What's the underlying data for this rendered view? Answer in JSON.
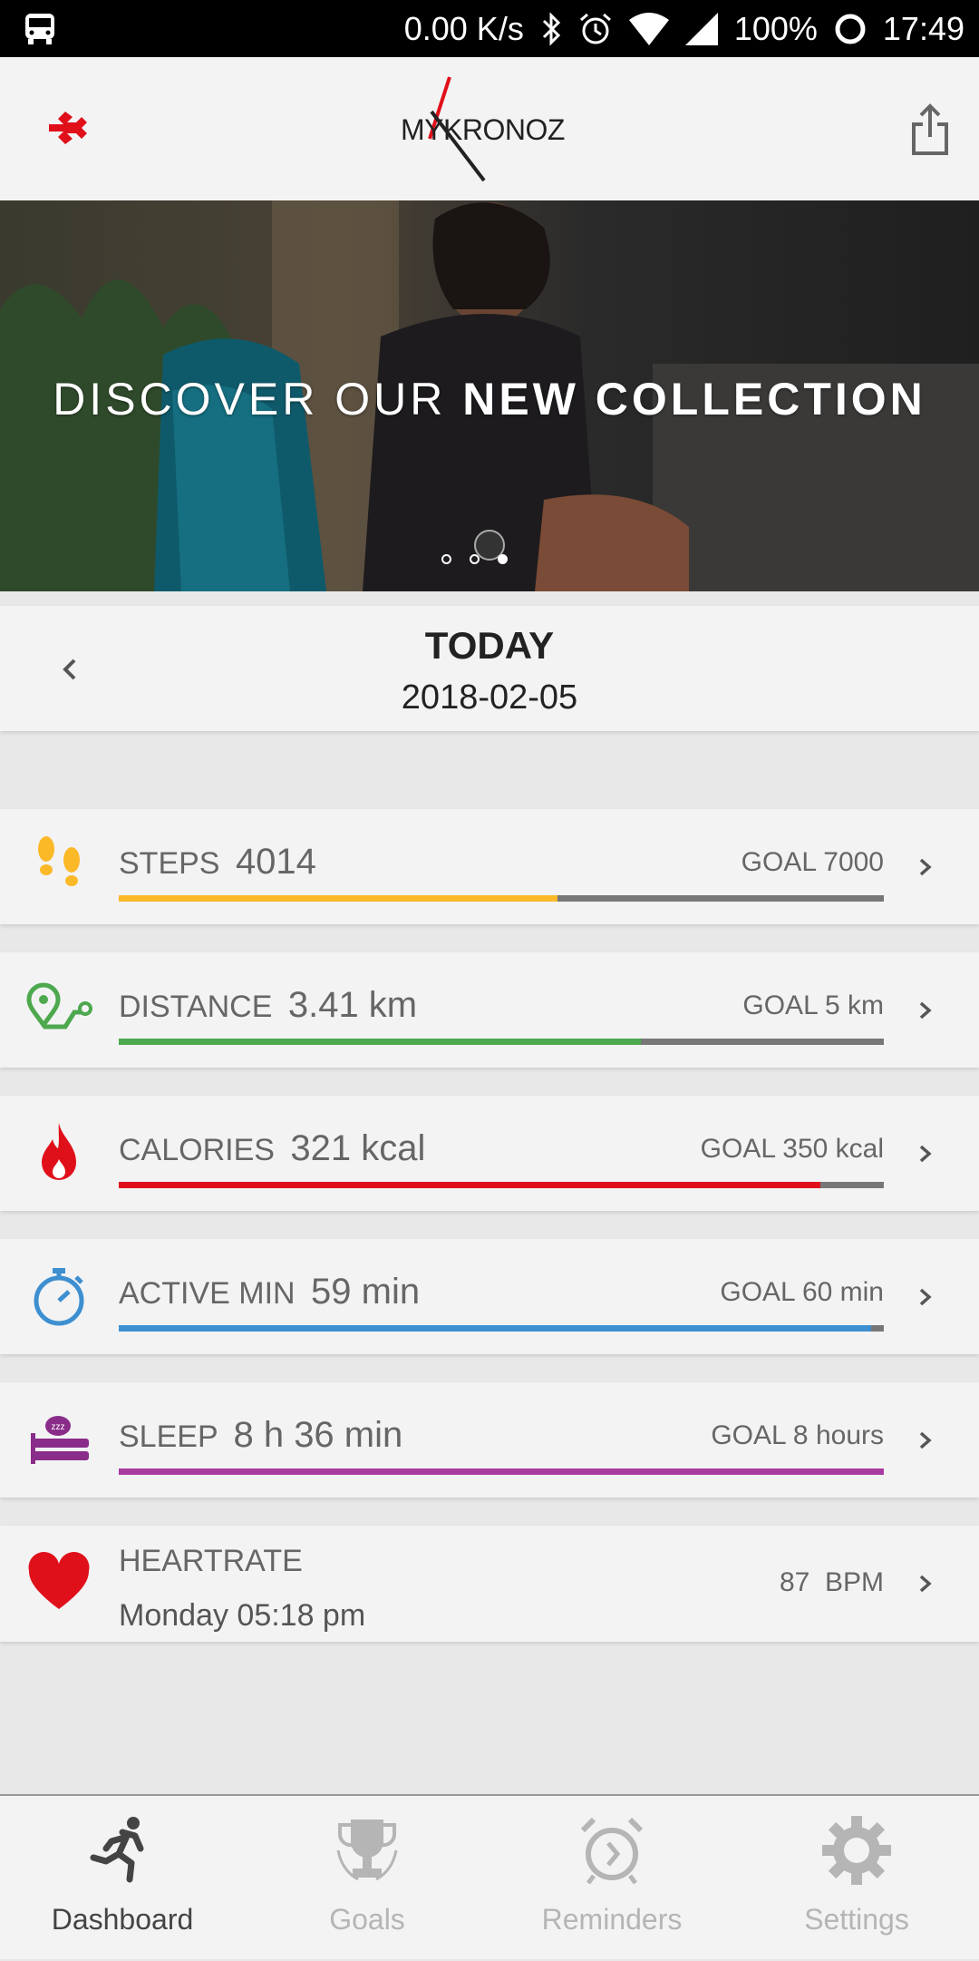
{
  "status_bar": {
    "net_speed": "0.00 K/s",
    "battery": "100%",
    "time": "17:49"
  },
  "app_bar": {
    "logo_text": "MYKRONOZ"
  },
  "banner": {
    "text_light": "DISCOVER OUR ",
    "text_bold": "NEW COLLECTION",
    "slides": 3,
    "active_slide": 3
  },
  "date_header": {
    "title": "TODAY",
    "date": "2018-02-05"
  },
  "metrics": [
    {
      "label": "STEPS",
      "value": "4014",
      "goal": "GOAL 7000",
      "progress": 0.573,
      "color": "#fbb928",
      "icon": "footprints-icon"
    },
    {
      "label": "DISTANCE",
      "value": "3.41 km",
      "goal": "GOAL 5 km",
      "progress": 0.682,
      "color": "#4da84e",
      "icon": "route-icon"
    },
    {
      "label": "CALORIES",
      "value": "321 kcal",
      "goal": "GOAL 350 kcal",
      "progress": 0.917,
      "color": "#e0101a",
      "icon": "flame-icon"
    },
    {
      "label": "ACTIVE MIN",
      "value": "59 min",
      "goal": "GOAL 60 min",
      "progress": 0.983,
      "color": "#3d8fd0",
      "icon": "stopwatch-icon"
    },
    {
      "label": "SLEEP",
      "value": "8 h 36 min",
      "goal": "GOAL 8 hours",
      "progress": 1.0,
      "color": "#a83ba0",
      "icon": "bed-icon"
    }
  ],
  "heartrate": {
    "label": "HEARTRATE",
    "time": "Monday 05:18 pm",
    "value": "87  BPM",
    "color": "#e0101a"
  },
  "tabs": [
    {
      "label": "Dashboard",
      "icon": "running-icon",
      "active": true
    },
    {
      "label": "Goals",
      "icon": "trophy-icon",
      "active": false
    },
    {
      "label": "Reminders",
      "icon": "alarm-clock-icon",
      "active": false
    },
    {
      "label": "Settings",
      "icon": "gear-icon",
      "active": false
    }
  ],
  "colors": {
    "active_tab": "#444444",
    "inactive_tab": "#b5b5b5",
    "brand_red": "#e0101a"
  }
}
